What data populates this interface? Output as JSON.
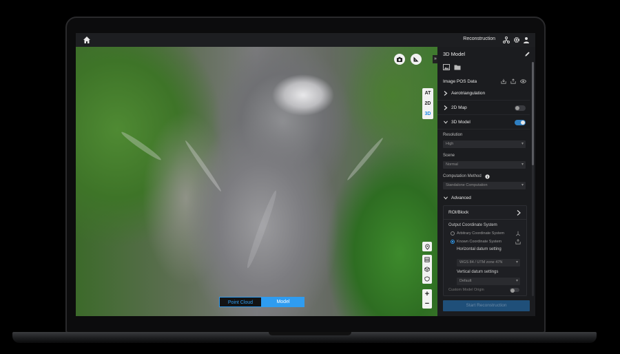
{
  "topbar": {
    "title": "Reconstruction",
    "icons": [
      "home-icon",
      "network-icon",
      "gear-icon",
      "user-icon"
    ]
  },
  "viewport": {
    "view_modes": [
      "AT",
      "2D",
      "3D"
    ],
    "active_view": "3D",
    "collapse_glyph": "»",
    "zoom_in": "+",
    "zoom_out": "−",
    "mode_switch": {
      "point_cloud": "Point Cloud",
      "model": "Model",
      "active": "Model"
    }
  },
  "panel": {
    "title": "3D Model",
    "image_pos_data": "Image POS Data",
    "sections": {
      "aerotriangulation": "Aerotriangulation",
      "map2d": "2D Map",
      "model3d": "3D Model",
      "map2d_enabled": false,
      "model3d_enabled": true
    },
    "resolution": {
      "label": "Resolution",
      "value": "High"
    },
    "scene": {
      "label": "Scene",
      "value": "Normal"
    },
    "computation": {
      "label": "Computation Method",
      "value": "Standalone Computation"
    },
    "advanced": "Advanced",
    "roi_block": "ROI/Block",
    "output_coord": "Output Coordinate System",
    "arbitrary": "Arbitrary Coordinate System",
    "known": "Known Coordinate System",
    "horizontal_label": "Horizontal datum setting",
    "horizontal_value": "WGS 84 / UTM zone 47N",
    "vertical_label": "Vertical datum settings",
    "vertical_value": "Default",
    "custom_origin": "Custom Model Origin",
    "start_button": "Start Reconstruction"
  },
  "colors": {
    "accent": "#2f9cf0",
    "panel_bg": "#1b1c1f"
  }
}
